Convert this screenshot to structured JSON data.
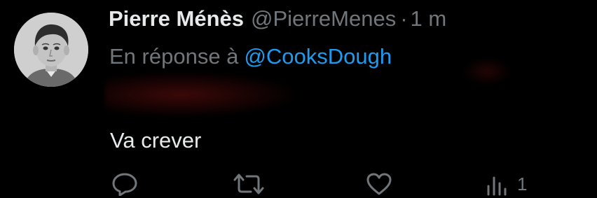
{
  "author": {
    "name": "Pierre Ménès",
    "handle": "@PierreMenes",
    "separator": "·",
    "time": "1 m"
  },
  "reply": {
    "prefix": "En réponse à",
    "to_handle": "@CooksDough"
  },
  "body": {
    "text": "Va crever"
  },
  "actions": {
    "reply_icon": "reply-icon",
    "retweet_icon": "retweet-icon",
    "like_icon": "heart-icon",
    "views_icon": "views-icon",
    "views_count": "1"
  },
  "colors": {
    "background": "#000000",
    "primary_text": "#e7e9ea",
    "secondary_text": "#71767b",
    "link": "#1d9bf0"
  }
}
